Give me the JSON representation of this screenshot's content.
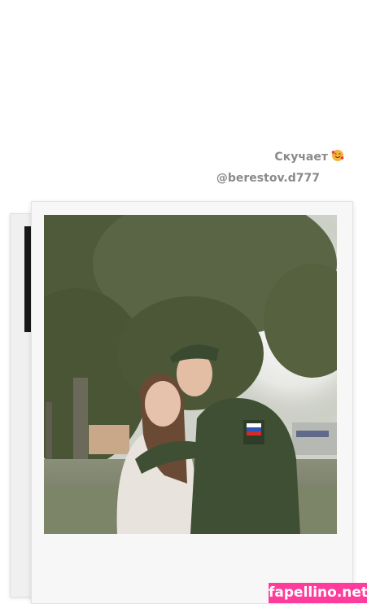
{
  "story": {
    "caption_text": "Скучает",
    "caption_emoji": "smiling-face-with-hearts-emoji",
    "mention": "@berestov.d777"
  },
  "photo": {
    "description_icon": "couple-photo"
  },
  "watermark": {
    "text": "fapellino.net"
  },
  "colors": {
    "caption": "#8a8a8a",
    "watermark_bg": "#ff3c9b",
    "foliage": "#4f5a3a",
    "uniform": "#3f4f34"
  }
}
